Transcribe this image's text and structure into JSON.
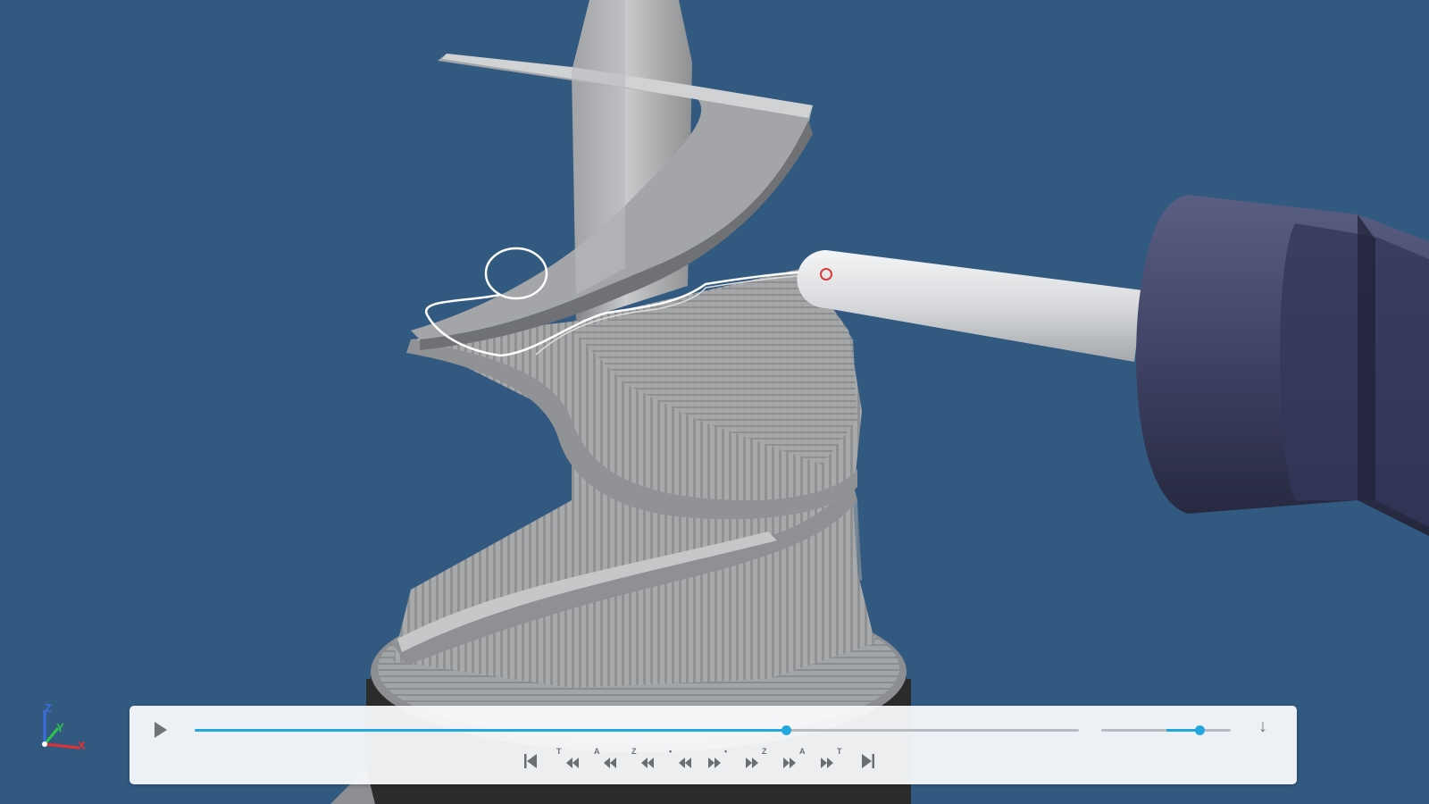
{
  "axes": {
    "x": "X",
    "y": "Y",
    "z": "Z"
  },
  "player": {
    "progress": 0.669,
    "speed": 0.76,
    "download_glyph": "↓",
    "play_icon": "play-icon",
    "step_buttons": [
      {
        "name": "first-step-button",
        "icon": "skip-to-start-icon",
        "label": ""
      },
      {
        "name": "back-toolpath-button",
        "icon": "step-back-icon",
        "label": "T"
      },
      {
        "name": "back-operation-button",
        "icon": "step-back-icon",
        "label": "A"
      },
      {
        "name": "back-z-level-button",
        "icon": "step-back-icon",
        "label": "Z"
      },
      {
        "name": "back-point-button",
        "icon": "step-back-icon",
        "label": "•"
      },
      {
        "name": "forward-point-button",
        "icon": "step-forward-icon",
        "label": "•"
      },
      {
        "name": "forward-z-level-button",
        "icon": "step-forward-icon",
        "label": "Z"
      },
      {
        "name": "forward-operation-button",
        "icon": "step-forward-icon",
        "label": "A"
      },
      {
        "name": "forward-toolpath-button",
        "icon": "step-forward-icon",
        "label": "T"
      },
      {
        "name": "last-step-button",
        "icon": "skip-to-end-icon",
        "label": ""
      }
    ]
  },
  "colors": {
    "background": "#325a80",
    "accent": "#22a7df",
    "part": "#a9abad",
    "tool_holder": "#3c3f5c"
  }
}
